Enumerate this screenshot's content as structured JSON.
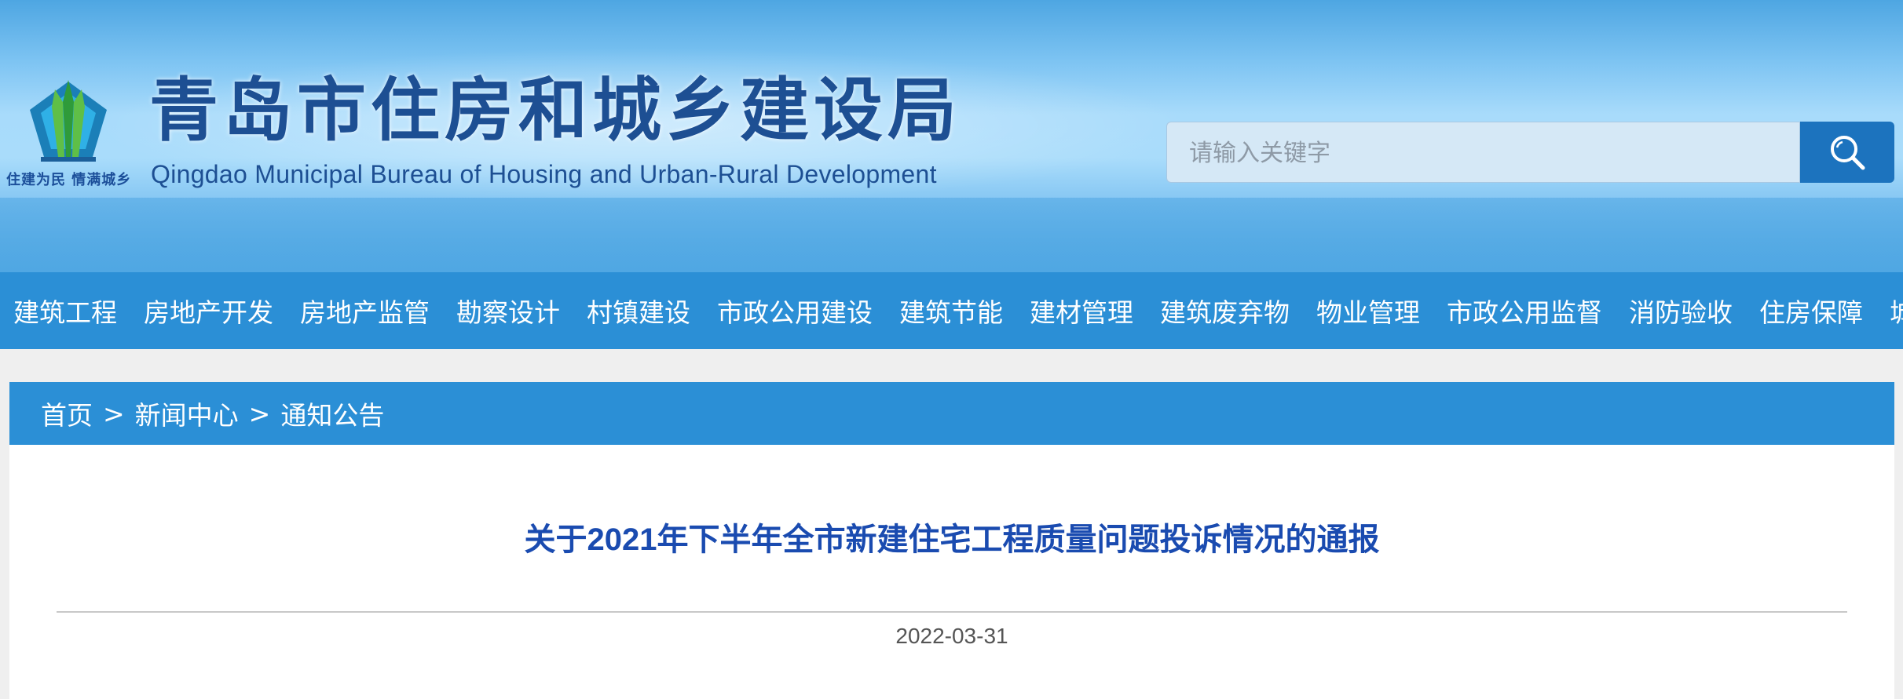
{
  "header": {
    "slogan": "住建为民 情满城乡",
    "title": "青岛市住房和城乡建设局",
    "subtitle": "Qingdao Municipal Bureau of Housing and Urban-Rural Development",
    "search_placeholder": "请输入关键字",
    "search_icon": "search-icon"
  },
  "nav": {
    "items": [
      "建筑工程",
      "房地产开发",
      "房地产监管",
      "勘察设计",
      "村镇建设",
      "市政公用建设",
      "建筑节能",
      "建材管理",
      "建筑废弃物",
      "物业管理",
      "市政公用监督",
      "消防验收",
      "住房保障",
      "城建"
    ]
  },
  "breadcrumb": {
    "items": [
      "首页",
      "新闻中心",
      "通知公告"
    ],
    "separator": ">"
  },
  "article": {
    "title": "关于2021年下半年全市新建住宅工程质量问题投诉情况的通报",
    "date": "2022-03-31"
  },
  "colors": {
    "nav_bg": "#2b8fd6",
    "title_blue": "#1a4bb0",
    "brand_blue": "#1d4f93",
    "search_btn": "#1c73be"
  }
}
